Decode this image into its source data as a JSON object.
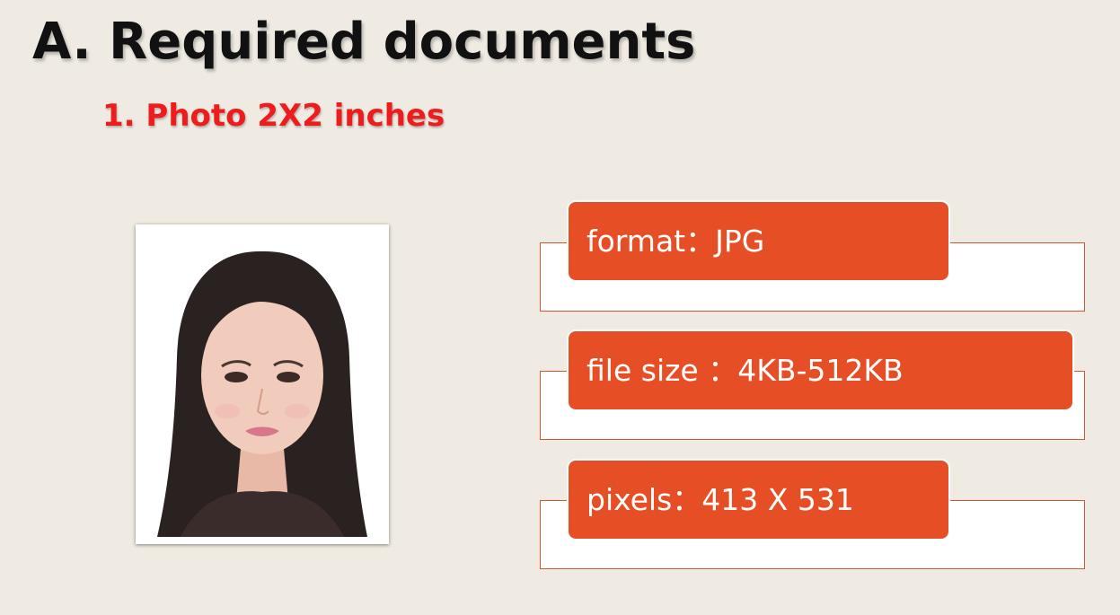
{
  "heading": {
    "title": "A. Required documents",
    "subtitle": "1. Photo 2X2 inches"
  },
  "specs": [
    {
      "label": "format：JPG"
    },
    {
      "label": "file size ：4KB-512KB"
    },
    {
      "label": "pixels：413 X 531"
    }
  ],
  "colors": {
    "background": "#efebe2",
    "accent": "#e64f25",
    "subtitle": "#ee1c1c",
    "box_border": "#d9532f"
  }
}
